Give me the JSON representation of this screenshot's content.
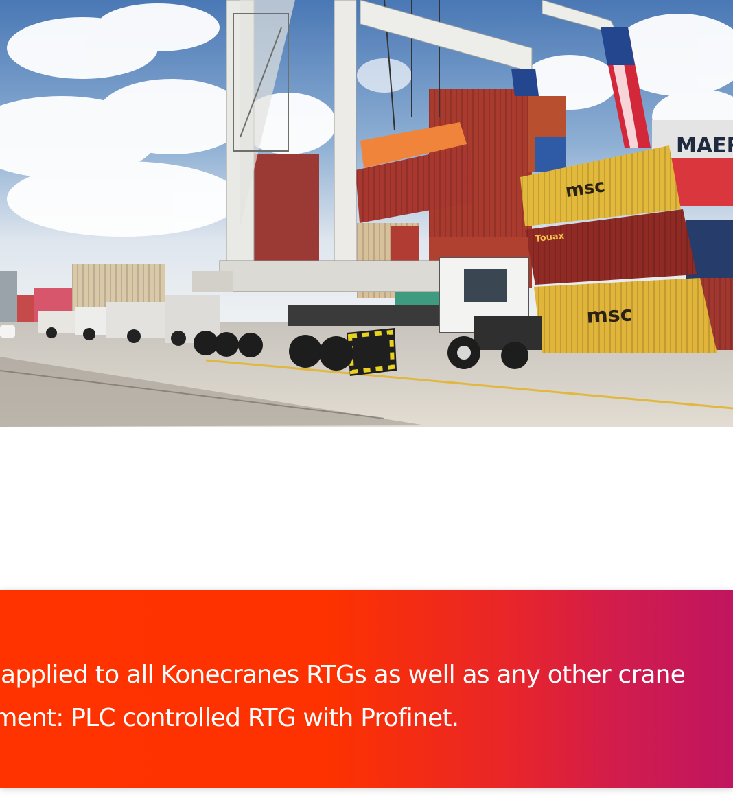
{
  "hero": {
    "container_labels": [
      "MAERS",
      "msc",
      "Touax",
      "msc"
    ]
  },
  "banner": {
    "line1": "e applied to all Konecranes RTGs as well as any other crane",
    "line2": "ement: PLC controlled RTG with Profinet.",
    "gradient_start": "#ff3300",
    "gradient_end": "#c0155f"
  }
}
